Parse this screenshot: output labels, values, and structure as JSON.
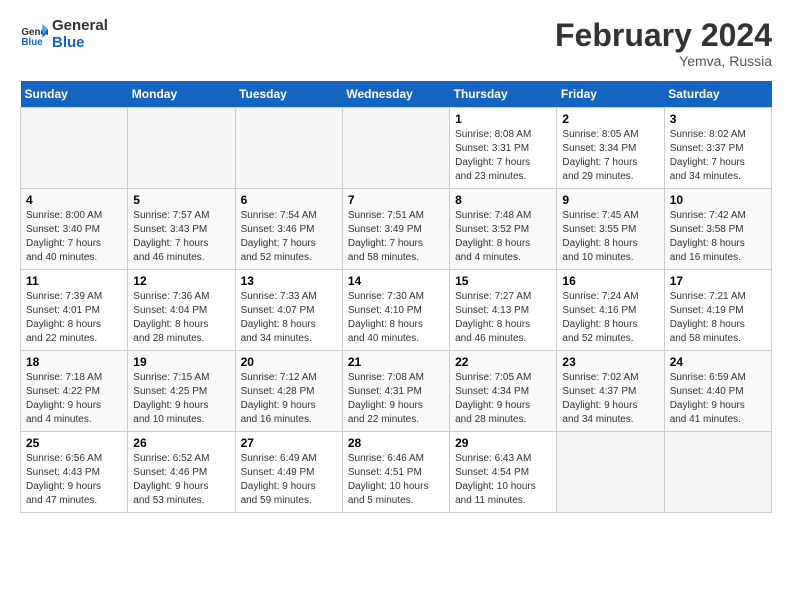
{
  "header": {
    "logo_line1": "General",
    "logo_line2": "Blue",
    "main_title": "February 2024",
    "subtitle": "Yemva, Russia"
  },
  "days_of_week": [
    "Sunday",
    "Monday",
    "Tuesday",
    "Wednesday",
    "Thursday",
    "Friday",
    "Saturday"
  ],
  "weeks": [
    [
      {
        "day": "",
        "info": ""
      },
      {
        "day": "",
        "info": ""
      },
      {
        "day": "",
        "info": ""
      },
      {
        "day": "",
        "info": ""
      },
      {
        "day": "1",
        "info": "Sunrise: 8:08 AM\nSunset: 3:31 PM\nDaylight: 7 hours\nand 23 minutes."
      },
      {
        "day": "2",
        "info": "Sunrise: 8:05 AM\nSunset: 3:34 PM\nDaylight: 7 hours\nand 29 minutes."
      },
      {
        "day": "3",
        "info": "Sunrise: 8:02 AM\nSunset: 3:37 PM\nDaylight: 7 hours\nand 34 minutes."
      }
    ],
    [
      {
        "day": "4",
        "info": "Sunrise: 8:00 AM\nSunset: 3:40 PM\nDaylight: 7 hours\nand 40 minutes."
      },
      {
        "day": "5",
        "info": "Sunrise: 7:57 AM\nSunset: 3:43 PM\nDaylight: 7 hours\nand 46 minutes."
      },
      {
        "day": "6",
        "info": "Sunrise: 7:54 AM\nSunset: 3:46 PM\nDaylight: 7 hours\nand 52 minutes."
      },
      {
        "day": "7",
        "info": "Sunrise: 7:51 AM\nSunset: 3:49 PM\nDaylight: 7 hours\nand 58 minutes."
      },
      {
        "day": "8",
        "info": "Sunrise: 7:48 AM\nSunset: 3:52 PM\nDaylight: 8 hours\nand 4 minutes."
      },
      {
        "day": "9",
        "info": "Sunrise: 7:45 AM\nSunset: 3:55 PM\nDaylight: 8 hours\nand 10 minutes."
      },
      {
        "day": "10",
        "info": "Sunrise: 7:42 AM\nSunset: 3:58 PM\nDaylight: 8 hours\nand 16 minutes."
      }
    ],
    [
      {
        "day": "11",
        "info": "Sunrise: 7:39 AM\nSunset: 4:01 PM\nDaylight: 8 hours\nand 22 minutes."
      },
      {
        "day": "12",
        "info": "Sunrise: 7:36 AM\nSunset: 4:04 PM\nDaylight: 8 hours\nand 28 minutes."
      },
      {
        "day": "13",
        "info": "Sunrise: 7:33 AM\nSunset: 4:07 PM\nDaylight: 8 hours\nand 34 minutes."
      },
      {
        "day": "14",
        "info": "Sunrise: 7:30 AM\nSunset: 4:10 PM\nDaylight: 8 hours\nand 40 minutes."
      },
      {
        "day": "15",
        "info": "Sunrise: 7:27 AM\nSunset: 4:13 PM\nDaylight: 8 hours\nand 46 minutes."
      },
      {
        "day": "16",
        "info": "Sunrise: 7:24 AM\nSunset: 4:16 PM\nDaylight: 8 hours\nand 52 minutes."
      },
      {
        "day": "17",
        "info": "Sunrise: 7:21 AM\nSunset: 4:19 PM\nDaylight: 8 hours\nand 58 minutes."
      }
    ],
    [
      {
        "day": "18",
        "info": "Sunrise: 7:18 AM\nSunset: 4:22 PM\nDaylight: 9 hours\nand 4 minutes."
      },
      {
        "day": "19",
        "info": "Sunrise: 7:15 AM\nSunset: 4:25 PM\nDaylight: 9 hours\nand 10 minutes."
      },
      {
        "day": "20",
        "info": "Sunrise: 7:12 AM\nSunset: 4:28 PM\nDaylight: 9 hours\nand 16 minutes."
      },
      {
        "day": "21",
        "info": "Sunrise: 7:08 AM\nSunset: 4:31 PM\nDaylight: 9 hours\nand 22 minutes."
      },
      {
        "day": "22",
        "info": "Sunrise: 7:05 AM\nSunset: 4:34 PM\nDaylight: 9 hours\nand 28 minutes."
      },
      {
        "day": "23",
        "info": "Sunrise: 7:02 AM\nSunset: 4:37 PM\nDaylight: 9 hours\nand 34 minutes."
      },
      {
        "day": "24",
        "info": "Sunrise: 6:59 AM\nSunset: 4:40 PM\nDaylight: 9 hours\nand 41 minutes."
      }
    ],
    [
      {
        "day": "25",
        "info": "Sunrise: 6:56 AM\nSunset: 4:43 PM\nDaylight: 9 hours\nand 47 minutes."
      },
      {
        "day": "26",
        "info": "Sunrise: 6:52 AM\nSunset: 4:46 PM\nDaylight: 9 hours\nand 53 minutes."
      },
      {
        "day": "27",
        "info": "Sunrise: 6:49 AM\nSunset: 4:49 PM\nDaylight: 9 hours\nand 59 minutes."
      },
      {
        "day": "28",
        "info": "Sunrise: 6:46 AM\nSunset: 4:51 PM\nDaylight: 10 hours\nand 5 minutes."
      },
      {
        "day": "29",
        "info": "Sunrise: 6:43 AM\nSunset: 4:54 PM\nDaylight: 10 hours\nand 11 minutes."
      },
      {
        "day": "",
        "info": ""
      },
      {
        "day": "",
        "info": ""
      }
    ]
  ]
}
